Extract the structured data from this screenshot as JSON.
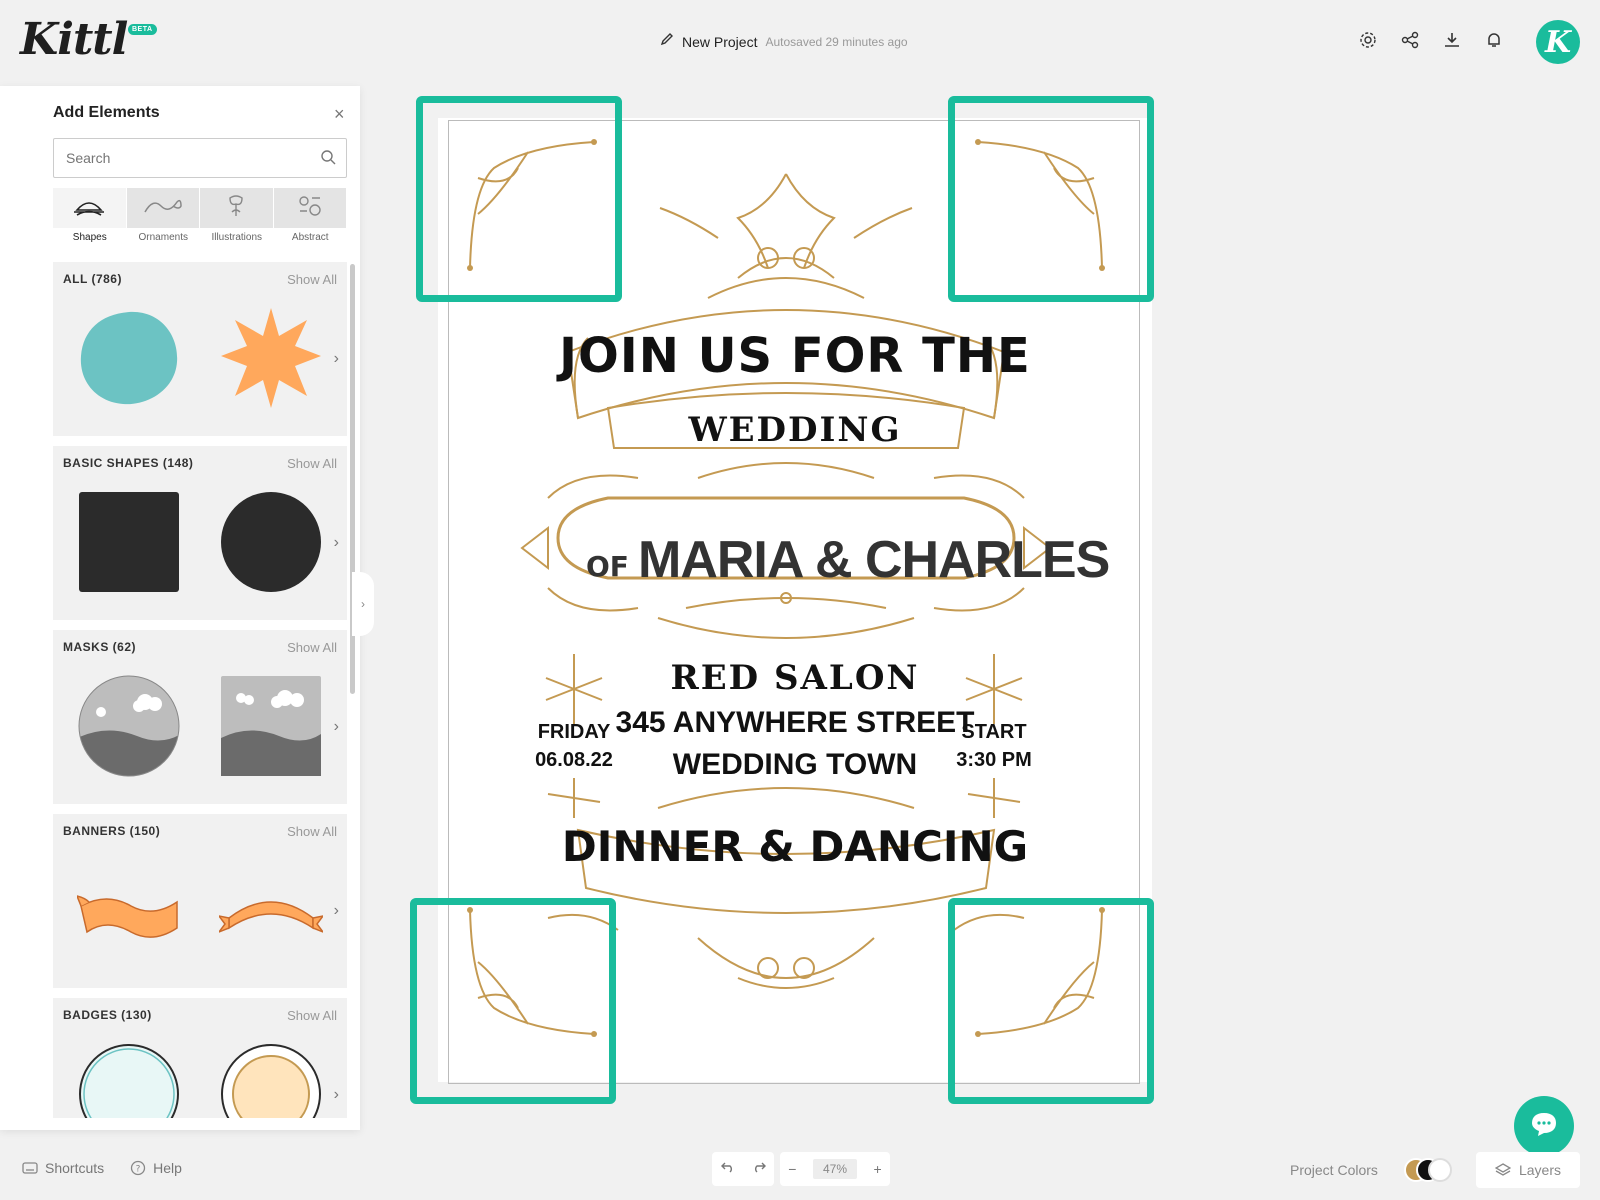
{
  "header": {
    "logo": "Kittl",
    "beta": "BETA",
    "project_name": "New Project",
    "autosave": "Autosaved 29 minutes ago",
    "avatar_letter": "K"
  },
  "panel": {
    "title": "Add Elements",
    "close": "×",
    "search_placeholder": "Search",
    "categories": [
      "Shapes",
      "Ornaments",
      "Illustrations",
      "Abstract"
    ],
    "sections": [
      {
        "title": "ALL (786)",
        "show_all": "Show All"
      },
      {
        "title": "BASIC SHAPES (148)",
        "show_all": "Show All"
      },
      {
        "title": "MASKS (62)",
        "show_all": "Show All"
      },
      {
        "title": "BANNERS (150)",
        "show_all": "Show All"
      },
      {
        "title": "BADGES (130)",
        "show_all": "Show All"
      }
    ]
  },
  "poster": {
    "line1": "JOIN US FOR THE",
    "line2": "WEDDING",
    "of": "OF",
    "names": "MARIA & CHARLES",
    "venue": "RED SALON",
    "street": "345 ANYWHERE STREET",
    "town": "WEDDING TOWN",
    "day": "FRIDAY",
    "date": "06.08.22",
    "start": "START",
    "time": "3:30 PM",
    "footer": "DINNER & DANCING"
  },
  "bottom": {
    "shortcuts": "Shortcuts",
    "help": "Help",
    "zoom": "47%",
    "zoom_minus": "−",
    "zoom_plus": "+",
    "project_colors": "Project Colors",
    "layers": "Layers"
  },
  "colors": {
    "accent": "#1abc9c",
    "gold": "#c49a52",
    "teal_blob": "#6cc3c3",
    "orange": "#ffa85c",
    "dark": "#2b2b2b"
  }
}
